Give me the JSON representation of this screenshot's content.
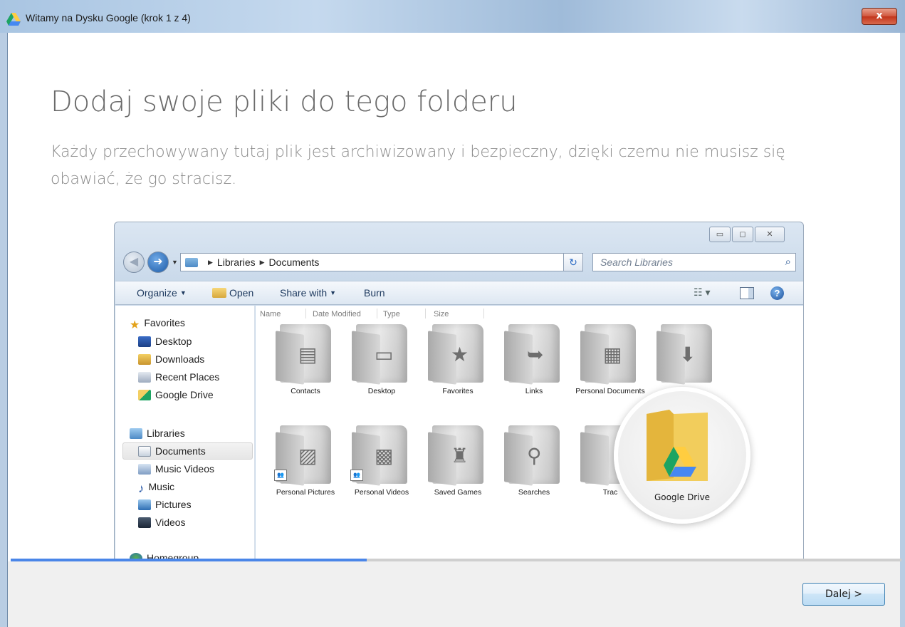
{
  "window": {
    "title": "Witamy na Dysku Google (krok 1 z 4)",
    "close_label": "x"
  },
  "wizard": {
    "headline": "Dodaj swoje pliki do tego folderu",
    "subtext": "Każdy przechowywany tutaj plik jest archiwizowany i bezpieczny, dzięki czemu nie musisz się obawiać, że go stracisz.",
    "progress_fraction": 0.4,
    "next_button": "Dalej >"
  },
  "explorer": {
    "breadcrumb": [
      "Libraries",
      "Documents"
    ],
    "search_placeholder": "Search Libraries",
    "toolbar": {
      "organize": "Organize",
      "open": "Open",
      "share_with": "Share with",
      "burn": "Burn"
    },
    "columns": [
      "Name",
      "Date Modified",
      "Type",
      "Size"
    ],
    "nav": {
      "favorites": "Favorites",
      "favorites_items": [
        "Desktop",
        "Downloads",
        "Recent Places",
        "Google Drive"
      ],
      "libraries": "Libraries",
      "libraries_items": [
        "Documents",
        "Music Videos",
        "Music",
        "Pictures",
        "Videos"
      ],
      "homegroup": "Homegroup"
    },
    "folders_row1": [
      "Contacts",
      "Desktop",
      "Favorites",
      "Links",
      "Personal Documents",
      ""
    ],
    "folders_row2": [
      "Personal Pictures",
      "Personal Videos",
      "Saved Games",
      "Searches",
      "Trac"
    ],
    "magnified_label": "Google Drive"
  },
  "colors": {
    "progress": "#4a86e8",
    "drive_green": "#1da462",
    "drive_yellow": "#ffcd40",
    "drive_blue": "#4688f1"
  }
}
